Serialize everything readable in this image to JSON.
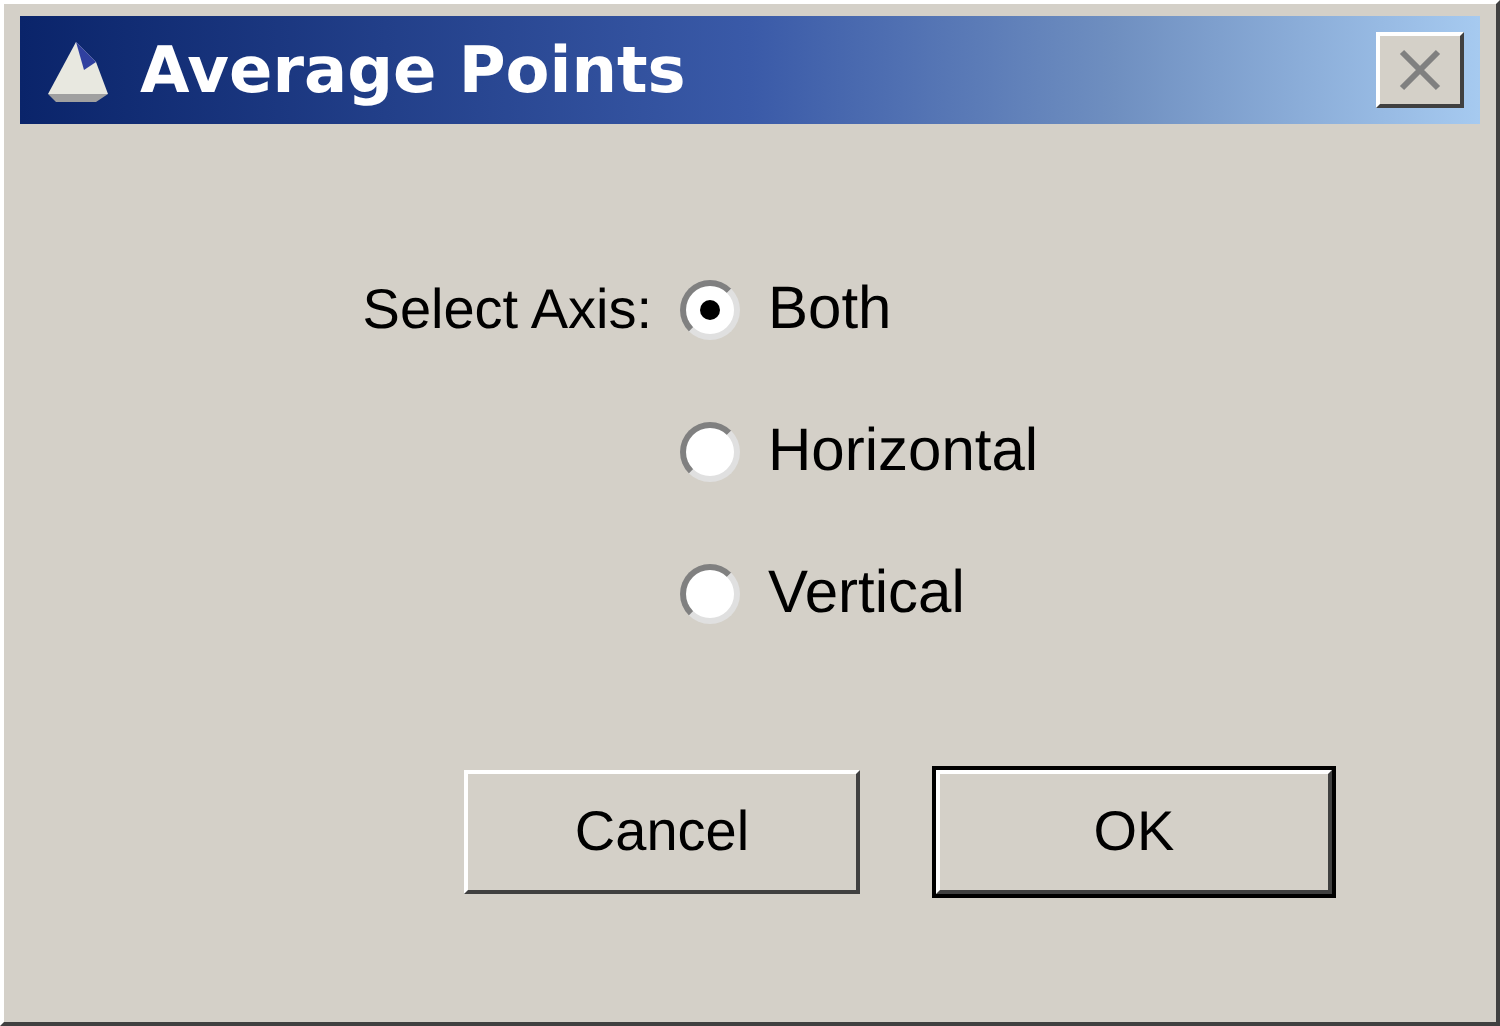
{
  "window": {
    "title": "Average Points"
  },
  "axis": {
    "label": "Select Axis:",
    "options": [
      {
        "label": "Both",
        "selected": true
      },
      {
        "label": "Horizontal",
        "selected": false
      },
      {
        "label": "Vertical",
        "selected": false
      }
    ]
  },
  "buttons": [
    {
      "label": "Cancel",
      "default": false
    },
    {
      "label": "OK",
      "default": true
    }
  ]
}
